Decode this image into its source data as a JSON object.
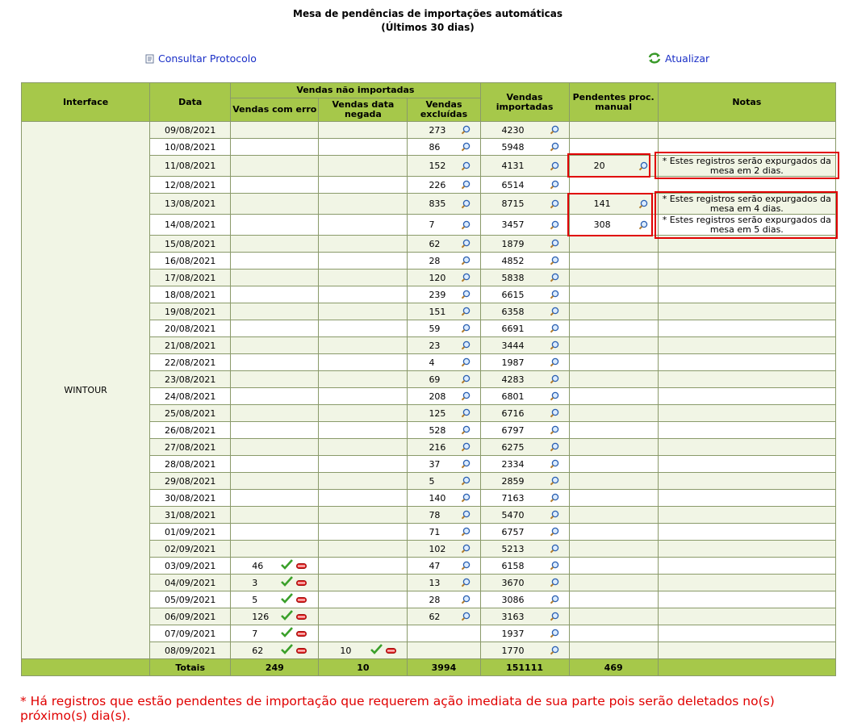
{
  "header": {
    "title": "Mesa de pendências de importações automáticas",
    "subtitle": "(Últimos 30 dias)"
  },
  "links": {
    "consultar": "Consultar Protocolo",
    "atualizar": "Atualizar"
  },
  "table": {
    "headers": {
      "interface": "Interface",
      "data": "Data",
      "vendas_nao_importadas": "Vendas não importadas",
      "vendas_com_erro": "Vendas com erro",
      "vendas_data_negada": "Vendas data negada",
      "vendas_excluidas": "Vendas excluídas",
      "vendas_importadas": "Vendas importadas",
      "pendentes": "Pendentes proc. manual",
      "notas": "Notas"
    },
    "interface_name": "WINTOUR",
    "rows": [
      {
        "date": "09/08/2021",
        "erro": "",
        "negada": "",
        "excl": "273",
        "imp": "4230",
        "pend": "",
        "nota": ""
      },
      {
        "date": "10/08/2021",
        "erro": "",
        "negada": "",
        "excl": "86",
        "imp": "5948",
        "pend": "",
        "nota": ""
      },
      {
        "date": "11/08/2021",
        "erro": "",
        "negada": "",
        "excl": "152",
        "imp": "4131",
        "pend": "20",
        "nota": "* Estes registros serão expurgados da mesa em 2 dias."
      },
      {
        "date": "12/08/2021",
        "erro": "",
        "negada": "",
        "excl": "226",
        "imp": "6514",
        "pend": "",
        "nota": ""
      },
      {
        "date": "13/08/2021",
        "erro": "",
        "negada": "",
        "excl": "835",
        "imp": "8715",
        "pend": "141",
        "nota": "* Estes registros serão expurgados da mesa em 4 dias."
      },
      {
        "date": "14/08/2021",
        "erro": "",
        "negada": "",
        "excl": "7",
        "imp": "3457",
        "pend": "308",
        "nota": "* Estes registros serão expurgados da mesa em 5 dias."
      },
      {
        "date": "15/08/2021",
        "erro": "",
        "negada": "",
        "excl": "62",
        "imp": "1879",
        "pend": "",
        "nota": ""
      },
      {
        "date": "16/08/2021",
        "erro": "",
        "negada": "",
        "excl": "28",
        "imp": "4852",
        "pend": "",
        "nota": ""
      },
      {
        "date": "17/08/2021",
        "erro": "",
        "negada": "",
        "excl": "120",
        "imp": "5838",
        "pend": "",
        "nota": ""
      },
      {
        "date": "18/08/2021",
        "erro": "",
        "negada": "",
        "excl": "239",
        "imp": "6615",
        "pend": "",
        "nota": ""
      },
      {
        "date": "19/08/2021",
        "erro": "",
        "negada": "",
        "excl": "151",
        "imp": "6358",
        "pend": "",
        "nota": ""
      },
      {
        "date": "20/08/2021",
        "erro": "",
        "negada": "",
        "excl": "59",
        "imp": "6691",
        "pend": "",
        "nota": ""
      },
      {
        "date": "21/08/2021",
        "erro": "",
        "negada": "",
        "excl": "23",
        "imp": "3444",
        "pend": "",
        "nota": ""
      },
      {
        "date": "22/08/2021",
        "erro": "",
        "negada": "",
        "excl": "4",
        "imp": "1987",
        "pend": "",
        "nota": ""
      },
      {
        "date": "23/08/2021",
        "erro": "",
        "negada": "",
        "excl": "69",
        "imp": "4283",
        "pend": "",
        "nota": ""
      },
      {
        "date": "24/08/2021",
        "erro": "",
        "negada": "",
        "excl": "208",
        "imp": "6801",
        "pend": "",
        "nota": ""
      },
      {
        "date": "25/08/2021",
        "erro": "",
        "negada": "",
        "excl": "125",
        "imp": "6716",
        "pend": "",
        "nota": ""
      },
      {
        "date": "26/08/2021",
        "erro": "",
        "negada": "",
        "excl": "528",
        "imp": "6797",
        "pend": "",
        "nota": ""
      },
      {
        "date": "27/08/2021",
        "erro": "",
        "negada": "",
        "excl": "216",
        "imp": "6275",
        "pend": "",
        "nota": ""
      },
      {
        "date": "28/08/2021",
        "erro": "",
        "negada": "",
        "excl": "37",
        "imp": "2334",
        "pend": "",
        "nota": ""
      },
      {
        "date": "29/08/2021",
        "erro": "",
        "negada": "",
        "excl": "5",
        "imp": "2859",
        "pend": "",
        "nota": ""
      },
      {
        "date": "30/08/2021",
        "erro": "",
        "negada": "",
        "excl": "140",
        "imp": "7163",
        "pend": "",
        "nota": ""
      },
      {
        "date": "31/08/2021",
        "erro": "",
        "negada": "",
        "excl": "78",
        "imp": "5470",
        "pend": "",
        "nota": ""
      },
      {
        "date": "01/09/2021",
        "erro": "",
        "negada": "",
        "excl": "71",
        "imp": "6757",
        "pend": "",
        "nota": ""
      },
      {
        "date": "02/09/2021",
        "erro": "",
        "negada": "",
        "excl": "102",
        "imp": "5213",
        "pend": "",
        "nota": ""
      },
      {
        "date": "03/09/2021",
        "erro": "46",
        "negada": "",
        "excl": "47",
        "imp": "6158",
        "pend": "",
        "nota": ""
      },
      {
        "date": "04/09/2021",
        "erro": "3",
        "negada": "",
        "excl": "13",
        "imp": "3670",
        "pend": "",
        "nota": ""
      },
      {
        "date": "05/09/2021",
        "erro": "5",
        "negada": "",
        "excl": "28",
        "imp": "3086",
        "pend": "",
        "nota": ""
      },
      {
        "date": "06/09/2021",
        "erro": "126",
        "negada": "",
        "excl": "62",
        "imp": "3163",
        "pend": "",
        "nota": ""
      },
      {
        "date": "07/09/2021",
        "erro": "7",
        "negada": "",
        "excl": "",
        "imp": "1937",
        "pend": "",
        "nota": ""
      },
      {
        "date": "08/09/2021",
        "erro": "62",
        "negada": "10",
        "excl": "",
        "imp": "1770",
        "pend": "",
        "nota": ""
      }
    ],
    "totals": {
      "label": "Totais",
      "erro": "249",
      "negada": "10",
      "excl": "3994",
      "imp": "151111",
      "pend": "469"
    }
  },
  "footnote": "* Há registros que estão pendentes de importação que requerem ação imediata de sua parte pois serão deletados no(s) próximo(s) dia(s).",
  "colors": {
    "header_green": "#a6c84a",
    "row_alt": "#f1f5e5",
    "link_blue": "#1a2fc7",
    "alert_red": "#e00000"
  }
}
